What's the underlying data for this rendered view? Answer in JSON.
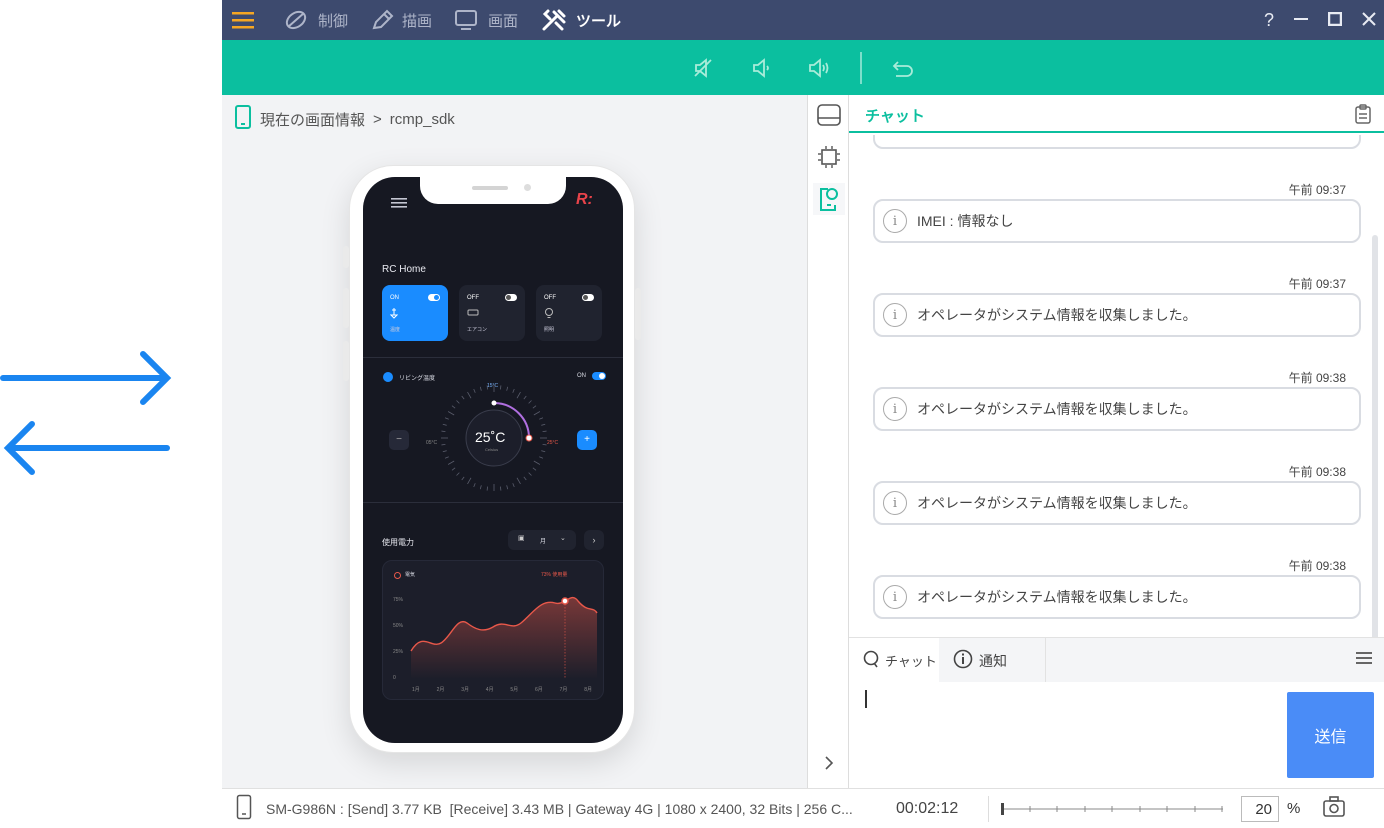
{
  "menu": {
    "items": [
      {
        "label": "制御",
        "icon": "control-icon"
      },
      {
        "label": "描画",
        "icon": "pen-icon"
      },
      {
        "label": "画面",
        "icon": "monitor-icon"
      },
      {
        "label": "ツール",
        "icon": "tools-icon"
      }
    ],
    "help": "?"
  },
  "toolbar": {
    "icons": [
      "mute-icon",
      "volume-down-icon",
      "volume-up-icon",
      "back-icon"
    ]
  },
  "breadcrumb": {
    "root": "現在の画面情報",
    "sep": ">",
    "current": "rcmp_sdk"
  },
  "device_screen": {
    "home_title": "RC Home",
    "cards": [
      {
        "status": "ON",
        "name": "温度"
      },
      {
        "status": "OFF",
        "name": "エアコン"
      },
      {
        "status": "OFF",
        "name": "照明"
      }
    ],
    "living_label": "リビング温度",
    "living_status": "ON",
    "temp": "25˚C",
    "temp_unit": "Celsius",
    "temp_top": "15°C",
    "temp_left": "05°C",
    "temp_right": "25°C",
    "power_title": "使用電力",
    "power_period": "月",
    "chart_legend": "電気",
    "chart_usage": "73% 使用量",
    "y_ticks": [
      "75%",
      "50%",
      "25%",
      "0"
    ],
    "x_ticks": [
      "1月",
      "2月",
      "3月",
      "4月",
      "5月",
      "6月",
      "7月",
      "8月"
    ]
  },
  "chat": {
    "title": "チャット",
    "messages": [
      {
        "time": "午前 09:37",
        "text": "IMEI : 情報なし"
      },
      {
        "time": "午前 09:37",
        "text": "オペレータがシステム情報を収集しました。"
      },
      {
        "time": "午前 09:38",
        "text": "オペレータがシステム情報を収集しました。"
      },
      {
        "time": "午前 09:38",
        "text": "オペレータがシステム情報を収集しました。"
      },
      {
        "time": "午前 09:38",
        "text": "オペレータがシステム情報を収集しました。"
      }
    ],
    "tabs": [
      {
        "label": "チャット"
      },
      {
        "label": "通知"
      }
    ],
    "send_label": "送信"
  },
  "status": {
    "device_info": "SM-G986N : [Send] 3.77 KB  [Receive] 3.43 MB | Gateway 4G | 1080 x 2400, 32 Bits | 256 C...",
    "timer": "00:02:12",
    "zoom_value": "20",
    "zoom_unit": "%"
  },
  "colors": {
    "menubar": "#3d4a6e",
    "accent": "#0bbf9f",
    "send": "#4a8cf7",
    "arrow": "#1a85f0",
    "chart": "#e8584a"
  }
}
